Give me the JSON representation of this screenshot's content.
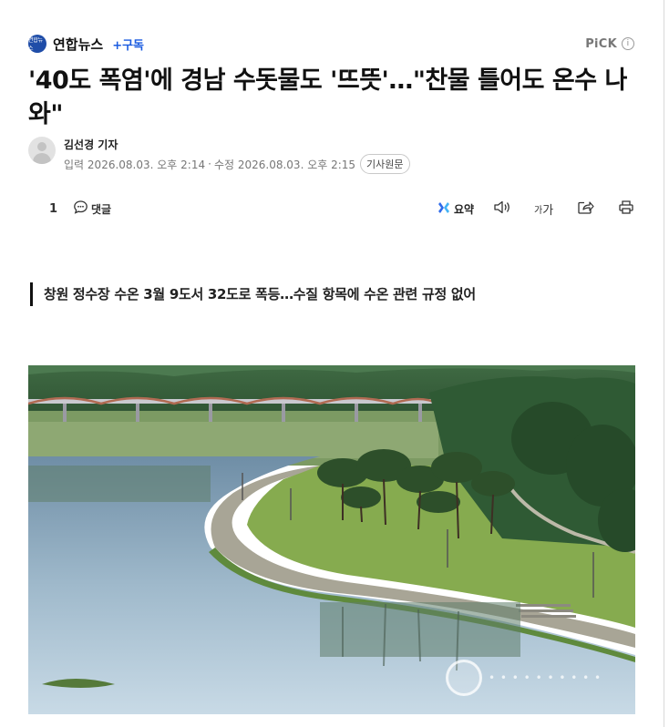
{
  "press": {
    "logo_text": "연합뉴스",
    "name": "연합뉴스",
    "subscribe_label": "+구독",
    "pick_label": "PiCK",
    "pick_info_icon": "i"
  },
  "article": {
    "headline": "'40도 폭염'에 경남 수돗물도 '뜨뜻'…\"찬물 틀어도 온수 나와\"",
    "reporter": "김선경 기자",
    "input_label": "입력",
    "input_date": "2026.08.03. 오후 2:14",
    "separator": "·",
    "modified_label": "수정",
    "modified_date": "2026.08.03. 오후 2:15",
    "original_link": "기사원문",
    "subheadline": "창원 정수장 수온 3월 9도서 32도로 폭등…수질 항목에 수온 관련 규정 없어"
  },
  "toolbar": {
    "reaction_count": "1",
    "comment_label": "댓글",
    "summary_label": "요약",
    "fontsize_small": "가",
    "fontsize_large": "가"
  },
  "icons": {
    "comment": "speech-bubble-icon",
    "summary": "sparkle-icon",
    "listen": "speaker-icon",
    "share": "share-icon",
    "print": "printer-icon"
  },
  "colors": {
    "accent": "#1a5be0",
    "press_logo": "#1f4da8",
    "text": "#111111",
    "muted": "#777777"
  }
}
